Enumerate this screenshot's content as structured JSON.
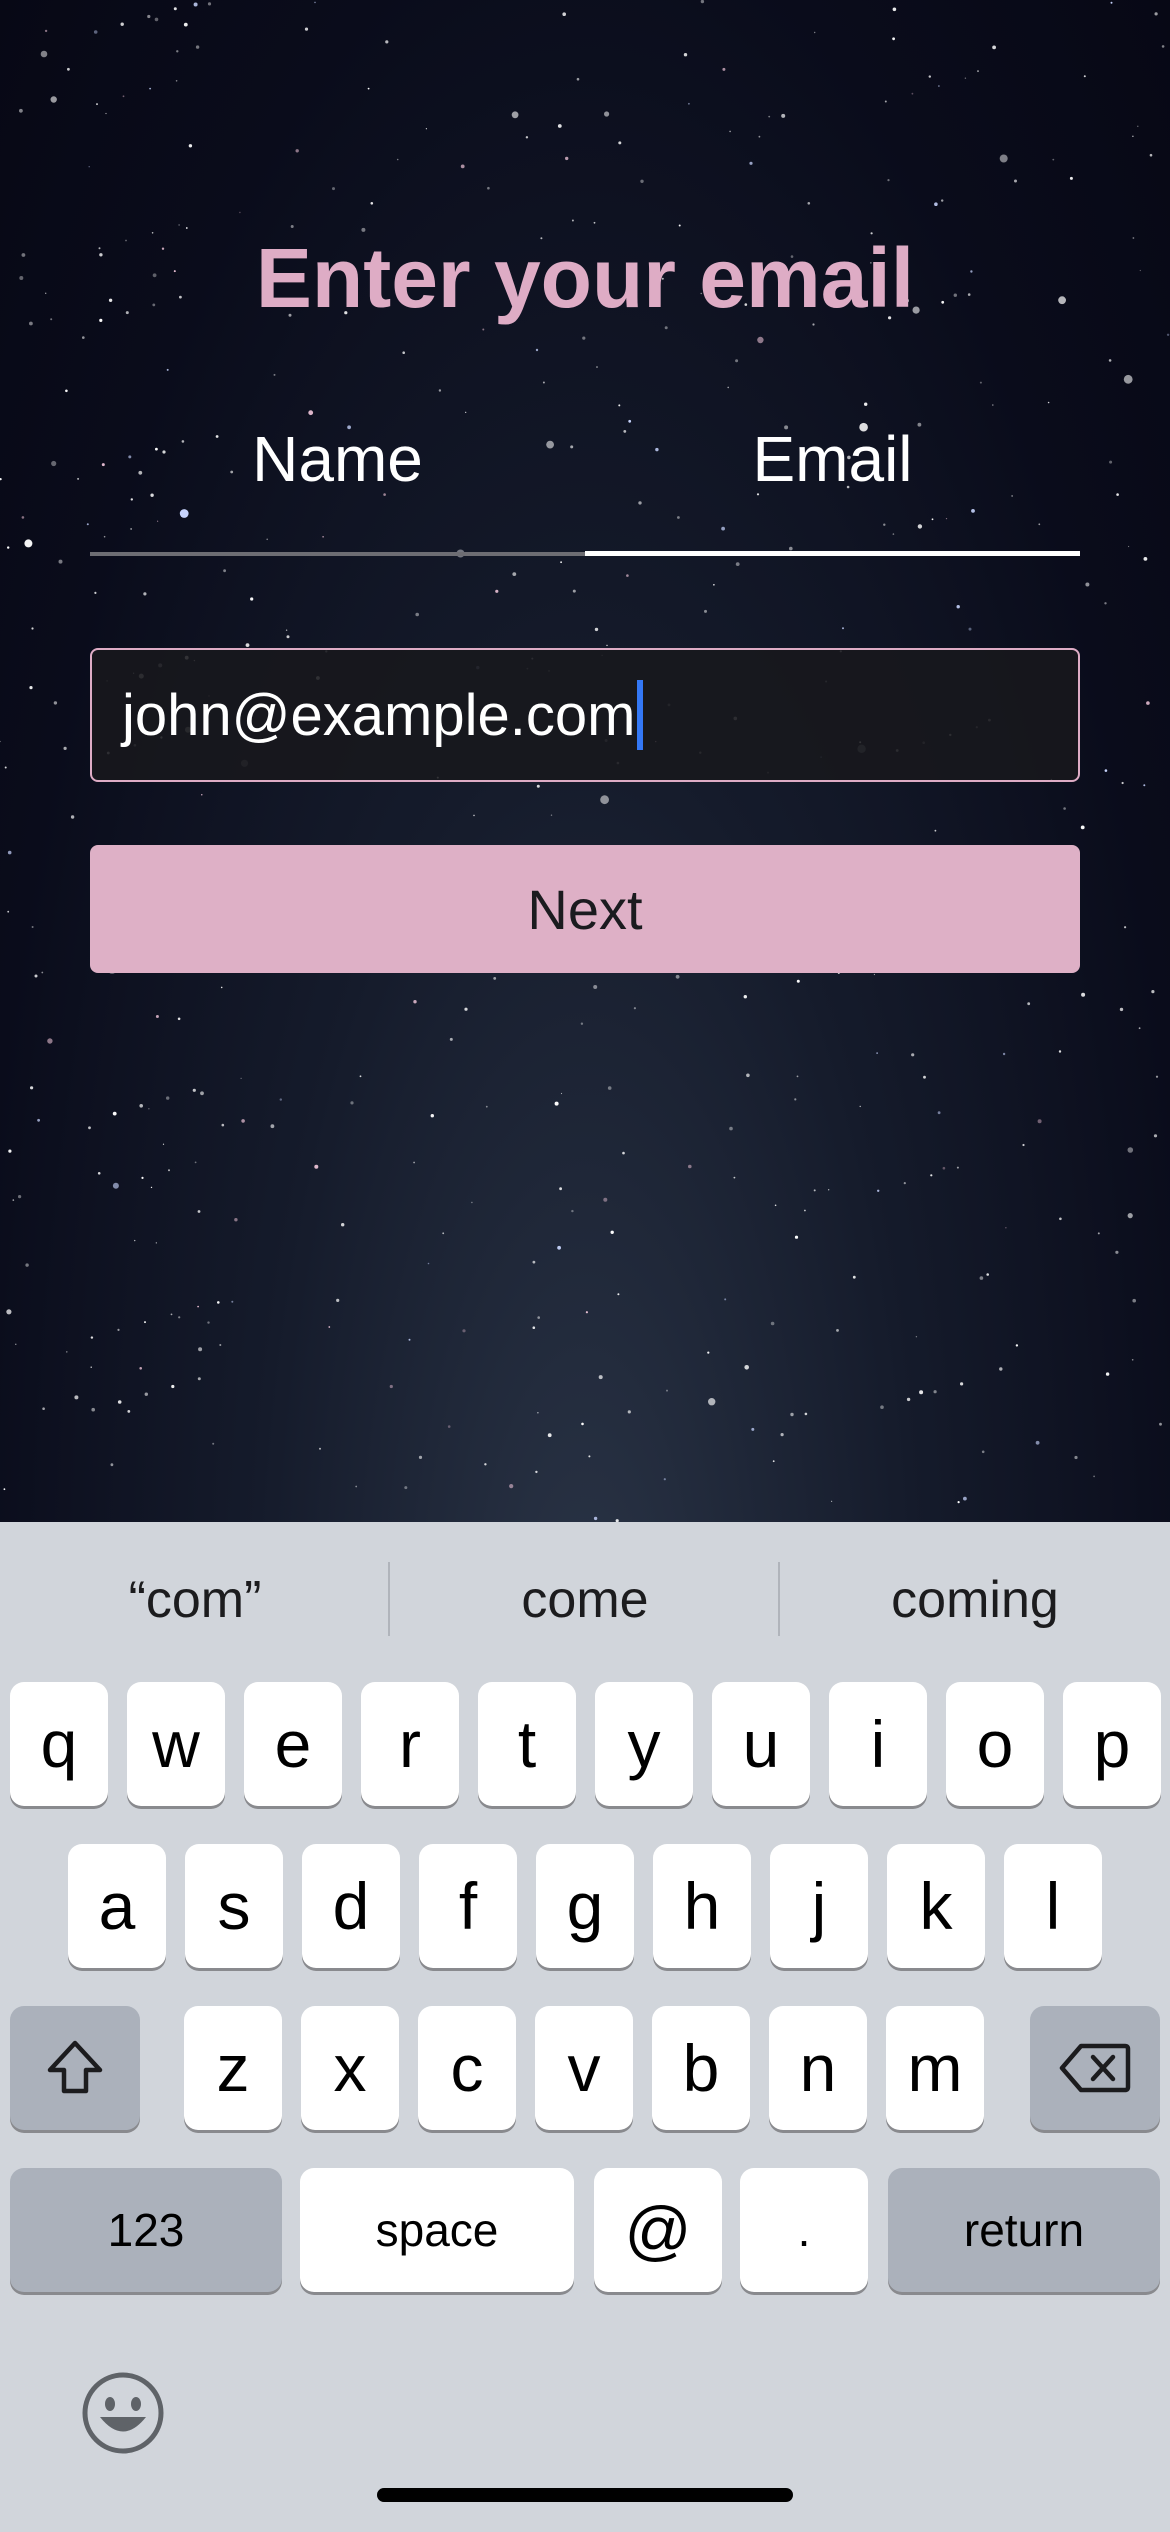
{
  "screen": {
    "title": "Enter your email",
    "tabs": [
      {
        "label": "Name",
        "active": false
      },
      {
        "label": "Email",
        "active": true
      }
    ],
    "email_field": {
      "value": "john@example.com"
    },
    "next_button": {
      "label": "Next"
    }
  },
  "keyboard": {
    "suggestions": [
      "“com”",
      "come",
      "coming"
    ],
    "row1": [
      "q",
      "w",
      "e",
      "r",
      "t",
      "y",
      "u",
      "i",
      "o",
      "p"
    ],
    "row2": [
      "a",
      "s",
      "d",
      "f",
      "g",
      "h",
      "j",
      "k",
      "l"
    ],
    "row3": [
      "z",
      "x",
      "c",
      "v",
      "b",
      "n",
      "m"
    ],
    "bottom": {
      "numbers": "123",
      "space": "space",
      "at": "@",
      "period": ".",
      "return": "return"
    },
    "icons": {
      "shift": "shift-icon",
      "delete": "delete-icon",
      "emoji": "emoji-icon"
    }
  },
  "colors": {
    "accent": "#deacc5",
    "button": "#deb0c6",
    "caret": "#3478f6",
    "keyboard_bg": "#d1d5db"
  }
}
